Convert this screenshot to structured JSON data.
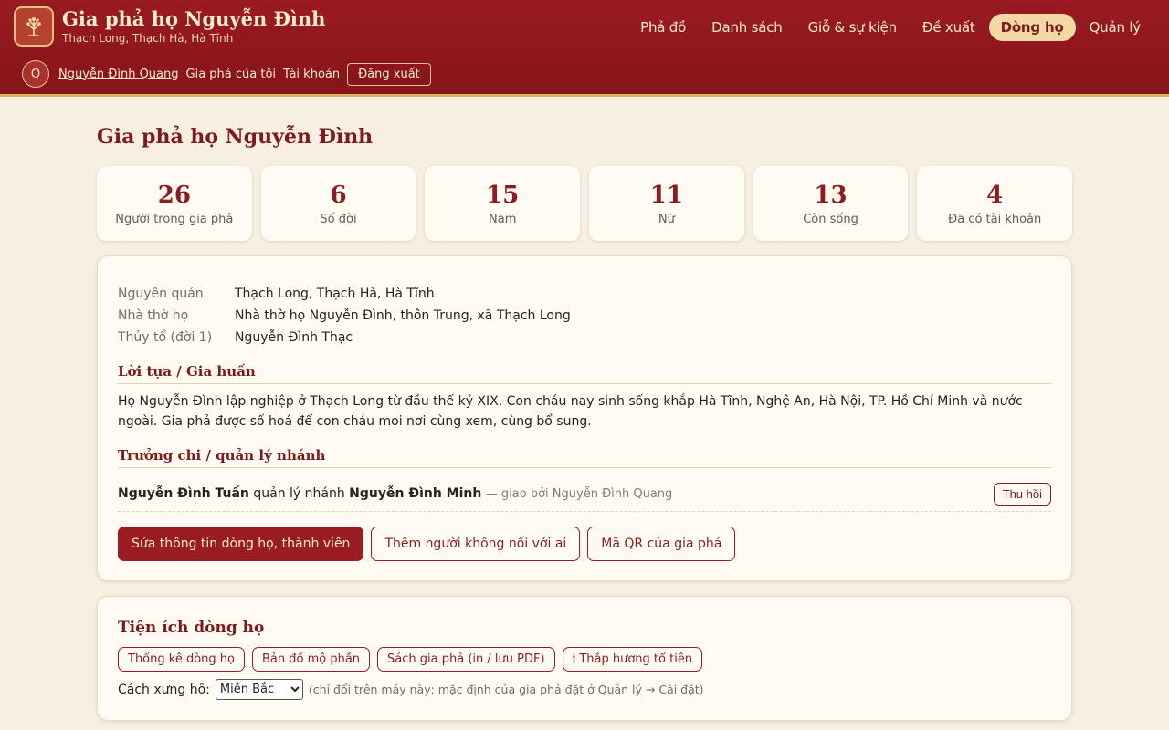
{
  "site": {
    "title": "Gia phả họ Nguyễn Đình",
    "subtitle": "Thạch Long, Thạch Hà, Hà Tĩnh"
  },
  "nav": {
    "items": [
      {
        "label": "Phả đồ",
        "active": false
      },
      {
        "label": "Danh sách",
        "active": false
      },
      {
        "label": "Giỗ & sự kiện",
        "active": false
      },
      {
        "label": "Đề xuất",
        "active": false
      },
      {
        "label": "Dòng họ",
        "active": true
      },
      {
        "label": "Quản lý",
        "active": false
      }
    ]
  },
  "user": {
    "avatar_initial": "Q",
    "name": "Nguyễn Đình Quang",
    "links": [
      "Gia phả của tôi",
      "Tài khoản"
    ],
    "logout_label": "Đăng xuất"
  },
  "page": {
    "title": "Gia phả họ Nguyễn Đình"
  },
  "stats": [
    {
      "value": "26",
      "label": "Người trong gia phả"
    },
    {
      "value": "6",
      "label": "Số đời"
    },
    {
      "value": "15",
      "label": "Nam"
    },
    {
      "value": "11",
      "label": "Nữ"
    },
    {
      "value": "13",
      "label": "Còn sống"
    },
    {
      "value": "4",
      "label": "Đã có tài khoản"
    }
  ],
  "info": {
    "rows": [
      {
        "key": "Nguyên quán",
        "value": "Thạch Long, Thạch Hà, Hà Tĩnh"
      },
      {
        "key": "Nhà thờ họ",
        "value": "Nhà thờ họ Nguyễn Đình, thôn Trung, xã Thạch Long"
      },
      {
        "key": "Thủy tổ (đời 1)",
        "value": "Nguyễn Đình Thạc"
      }
    ],
    "preface_title": "Lời tựa / Gia huấn",
    "preface_text": "Họ Nguyễn Đình lập nghiệp ở Thạch Long từ đầu thế kỷ XIX. Con cháu nay sinh sống khắp Hà Tĩnh, Nghệ An, Hà Nội, TP. Hồ Chí Minh và nước ngoài. Gia phả được số hoá để con cháu mọi nơi cùng xem, cùng bổ sung.",
    "managers_title": "Trưởng chi / quản lý nhánh",
    "manager": {
      "name": "Nguyễn Đình Tuấn",
      "middle": "quản lý nhánh",
      "branch": "Nguyễn Đình Minh",
      "note": "— giao bởi Nguyễn Đình Quang",
      "revoke_label": "Thu hồi"
    },
    "actions": {
      "edit": "Sửa thông tin dòng họ, thành viên",
      "add_unlinked": "Thêm người không nối với ai",
      "qr": "Mã QR của gia phả"
    }
  },
  "tools": {
    "title": "Tiện ích dòng họ",
    "chips": [
      "Thống kê dòng họ",
      "Bản đồ mộ phần",
      "Sách gia phả (in / lưu PDF)",
      "🕯 Thắp hương tổ tiên"
    ],
    "address_label": "Cách xưng hô:",
    "address_selected": "Miền Bắc",
    "address_hint": "(chỉ đổi trên máy này; mặc định của gia phả đặt ở Quản lý → Cài đặt)"
  },
  "colors": {
    "brand": "#9a1b22",
    "accent_gold": "#d8b45a",
    "background": "#f6efe2",
    "card": "#fffbf3"
  }
}
